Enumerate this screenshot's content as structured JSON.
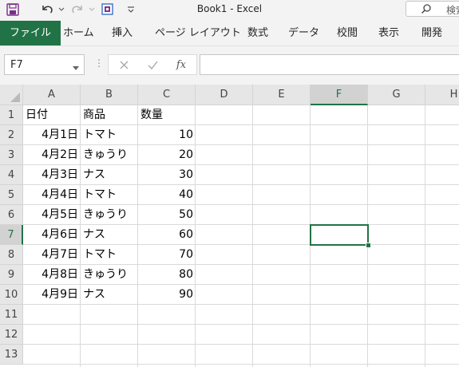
{
  "window": {
    "title": "Book1  -  Excel"
  },
  "search": {
    "label": "検索"
  },
  "ribbon": {
    "tabs": [
      {
        "label": "ファイル",
        "active": true
      },
      {
        "label": "ホーム"
      },
      {
        "label": "挿入"
      },
      {
        "label": "ページ レイアウト"
      },
      {
        "label": "数式"
      },
      {
        "label": "データ"
      },
      {
        "label": "校閲"
      },
      {
        "label": "表示"
      },
      {
        "label": "開発"
      }
    ]
  },
  "formula_bar": {
    "name_box": "F7",
    "fx_label": "fx",
    "content": ""
  },
  "sheet": {
    "columns": [
      "A",
      "B",
      "C",
      "D",
      "E",
      "F",
      "G",
      "H"
    ],
    "selected_column": "F",
    "rows": [
      "1",
      "2",
      "3",
      "4",
      "5",
      "6",
      "7",
      "8",
      "9",
      "10",
      "11",
      "12",
      "13"
    ],
    "selected_row": "7",
    "active_cell": "F7",
    "cells": [
      [
        "日付",
        "商品",
        "数量"
      ],
      [
        "4月1日",
        "トマト",
        "10"
      ],
      [
        "4月2日",
        "きゅうり",
        "20"
      ],
      [
        "4月3日",
        "ナス",
        "30"
      ],
      [
        "4月4日",
        "トマト",
        "40"
      ],
      [
        "4月5日",
        "きゅうり",
        "50"
      ],
      [
        "4月6日",
        "ナス",
        "60"
      ],
      [
        "4月7日",
        "トマト",
        "70"
      ],
      [
        "4月8日",
        "きゅうり",
        "80"
      ],
      [
        "4月9日",
        "ナス",
        "90"
      ]
    ]
  },
  "colors": {
    "accent": "#217346",
    "header_bg": "#e6e6e6",
    "chrome_bg": "#f3f3f3"
  },
  "icons": [
    "save-icon",
    "undo-icon",
    "redo-icon",
    "touch-mode-icon",
    "customize-qat-icon",
    "search-icon",
    "cancel-icon",
    "enter-icon",
    "insert-function-icon"
  ]
}
